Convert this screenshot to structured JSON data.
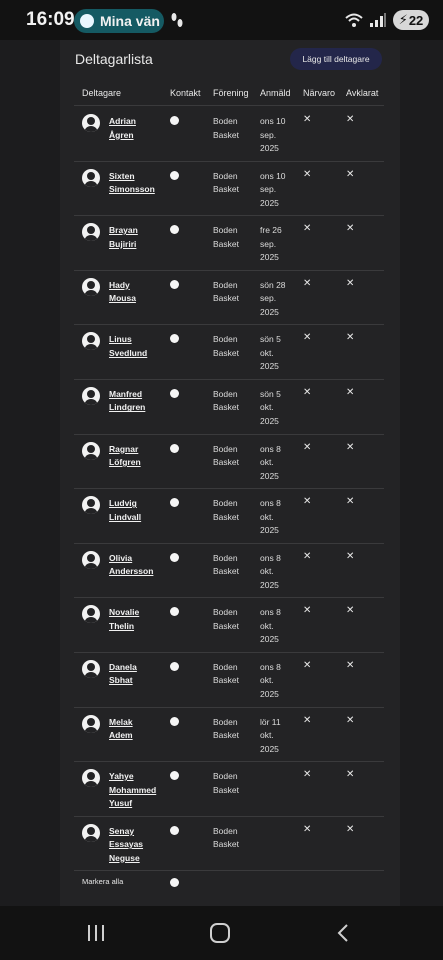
{
  "status_bar": {
    "time": "16:09",
    "notification_text": "Mina vän",
    "battery_level": "22",
    "icons": [
      "chat-bubble-icon",
      "footsteps-icon",
      "wifi-icon",
      "signal-icon",
      "battery-charging-icon"
    ]
  },
  "panel": {
    "title": "Deltagarlista",
    "add_button": "Lägg till deltagare"
  },
  "table": {
    "columns": [
      "Deltagare",
      "Kontakt",
      "Förening",
      "Anmäld",
      "Närvaro",
      "Avklarat"
    ],
    "rows": [
      {
        "name_line1": "Adrian",
        "name_line2": "Ågren",
        "name_line3": "",
        "club_line1": "Boden",
        "club_line2": "Basket",
        "date_line1": "ons 10",
        "date_line2": "sep.",
        "date_line3": "2025",
        "attendance": "✕",
        "completed": "✕"
      },
      {
        "name_line1": "Sixten",
        "name_line2": "Simonsson",
        "name_line3": "",
        "club_line1": "Boden",
        "club_line2": "Basket",
        "date_line1": "ons 10",
        "date_line2": "sep.",
        "date_line3": "2025",
        "attendance": "✕",
        "completed": "✕"
      },
      {
        "name_line1": "Brayan",
        "name_line2": "Bujiriri",
        "name_line3": "",
        "club_line1": "Boden",
        "club_line2": "Basket",
        "date_line1": "fre 26",
        "date_line2": "sep.",
        "date_line3": "2025",
        "attendance": "✕",
        "completed": "✕"
      },
      {
        "name_line1": "Hady",
        "name_line2": "Mousa",
        "name_line3": "",
        "club_line1": "Boden",
        "club_line2": "Basket",
        "date_line1": "sön 28",
        "date_line2": "sep.",
        "date_line3": "2025",
        "attendance": "✕",
        "completed": "✕"
      },
      {
        "name_line1": "Linus",
        "name_line2": "Svedlund",
        "name_line3": "",
        "club_line1": "Boden",
        "club_line2": "Basket",
        "date_line1": "sön 5",
        "date_line2": "okt.",
        "date_line3": "2025",
        "attendance": "✕",
        "completed": "✕"
      },
      {
        "name_line1": "Manfred",
        "name_line2": "Lindgren",
        "name_line3": "",
        "club_line1": "Boden",
        "club_line2": "Basket",
        "date_line1": "sön 5",
        "date_line2": "okt.",
        "date_line3": "2025",
        "attendance": "✕",
        "completed": "✕"
      },
      {
        "name_line1": "Ragnar",
        "name_line2": "Löfgren",
        "name_line3": "",
        "club_line1": "Boden",
        "club_line2": "Basket",
        "date_line1": "ons 8",
        "date_line2": "okt.",
        "date_line3": "2025",
        "attendance": "✕",
        "completed": "✕"
      },
      {
        "name_line1": "Ludvig",
        "name_line2": "Lindvall",
        "name_line3": "",
        "club_line1": "Boden",
        "club_line2": "Basket",
        "date_line1": "ons 8",
        "date_line2": "okt.",
        "date_line3": "2025",
        "attendance": "✕",
        "completed": "✕"
      },
      {
        "name_line1": "Olivia",
        "name_line2": "Andersson",
        "name_line3": "",
        "club_line1": "Boden",
        "club_line2": "Basket",
        "date_line1": "ons 8",
        "date_line2": "okt.",
        "date_line3": "2025",
        "attendance": "✕",
        "completed": "✕"
      },
      {
        "name_line1": "Novalie",
        "name_line2": "Thelin",
        "name_line3": "",
        "club_line1": "Boden",
        "club_line2": "Basket",
        "date_line1": "ons 8",
        "date_line2": "okt.",
        "date_line3": "2025",
        "attendance": "✕",
        "completed": "✕"
      },
      {
        "name_line1": "Danela",
        "name_line2": "Sbhat",
        "name_line3": "",
        "club_line1": "Boden",
        "club_line2": "Basket",
        "date_line1": "ons 8",
        "date_line2": "okt.",
        "date_line3": "2025",
        "attendance": "✕",
        "completed": "✕"
      },
      {
        "name_line1": "Melak",
        "name_line2": "Adem",
        "name_line3": "",
        "club_line1": "Boden",
        "club_line2": "Basket",
        "date_line1": "lör 11",
        "date_line2": "okt.",
        "date_line3": "2025",
        "attendance": "✕",
        "completed": "✕"
      },
      {
        "name_line1": "Yahye",
        "name_line2": "Mohammed",
        "name_line3": "Yusuf",
        "club_line1": "Boden",
        "club_line2": "Basket",
        "date_line1": "",
        "date_line2": "",
        "date_line3": "",
        "attendance": "✕",
        "completed": "✕"
      },
      {
        "name_line1": "Senay",
        "name_line2": "Essayas",
        "name_line3": "Neguse",
        "club_line1": "Boden",
        "club_line2": "Basket",
        "date_line1": "",
        "date_line2": "",
        "date_line3": "",
        "attendance": "✕",
        "completed": "✕"
      }
    ],
    "select_all_label": "Markera alla"
  },
  "nav_bar": {
    "icons": [
      "recent-apps-icon",
      "home-icon",
      "back-icon"
    ]
  },
  "colors": {
    "background": "#1c1c1e",
    "panel": "#232325",
    "accent_button": "#23264a",
    "pill": "#155a63"
  }
}
